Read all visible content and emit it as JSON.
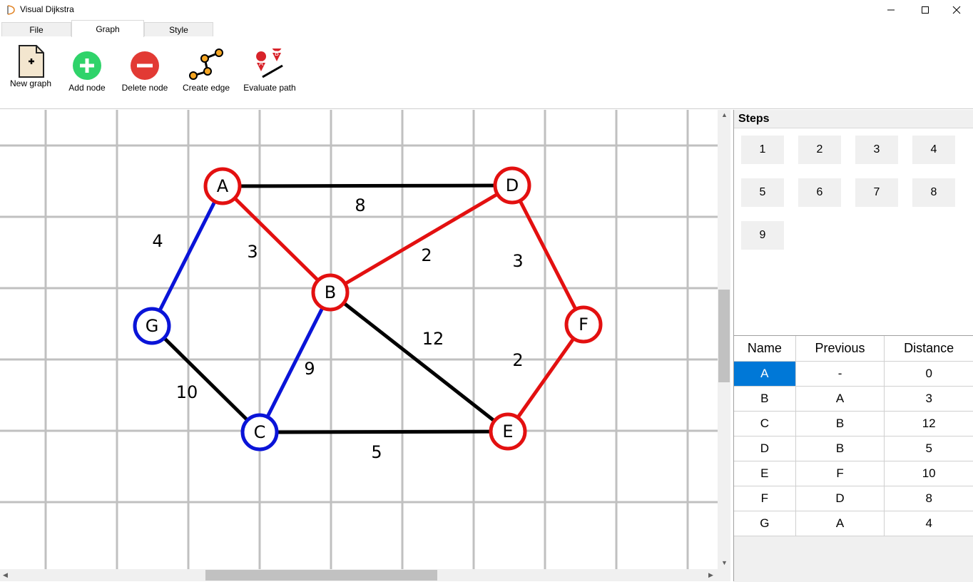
{
  "window": {
    "title": "Visual Dijkstra"
  },
  "tabs": [
    {
      "label": "File"
    },
    {
      "label": "Graph"
    },
    {
      "label": "Style"
    }
  ],
  "ribbon": {
    "new_graph": "New graph",
    "add_node": "Add node",
    "delete_node": "Delete node",
    "create_edge": "Create edge",
    "evaluate_path": "Evaluate path"
  },
  "graph": {
    "nodes": [
      {
        "id": "A",
        "color": "#e31010"
      },
      {
        "id": "B",
        "color": "#e31010"
      },
      {
        "id": "C",
        "color": "#0a14d8"
      },
      {
        "id": "D",
        "color": "#e31010"
      },
      {
        "id": "E",
        "color": "#e31010"
      },
      {
        "id": "F",
        "color": "#e31010"
      },
      {
        "id": "G",
        "color": "#0a14d8"
      }
    ],
    "edges": [
      {
        "from": "A",
        "to": "D",
        "weight": "8",
        "color": "#000000"
      },
      {
        "from": "A",
        "to": "B",
        "weight": "3",
        "color": "#e31010"
      },
      {
        "from": "A",
        "to": "G",
        "weight": "4",
        "color": "#0a14d8"
      },
      {
        "from": "B",
        "to": "D",
        "weight": "2",
        "color": "#e31010"
      },
      {
        "from": "D",
        "to": "F",
        "weight": "3",
        "color": "#e31010"
      },
      {
        "from": "B",
        "to": "E",
        "weight": "12",
        "color": "#000000"
      },
      {
        "from": "B",
        "to": "C",
        "weight": "9",
        "color": "#0a14d8"
      },
      {
        "from": "F",
        "to": "E",
        "weight": "2",
        "color": "#e31010"
      },
      {
        "from": "G",
        "to": "C",
        "weight": "10",
        "color": "#000000"
      },
      {
        "from": "C",
        "to": "E",
        "weight": "5",
        "color": "#000000"
      }
    ]
  },
  "steps": {
    "title": "Steps",
    "items": [
      "1",
      "2",
      "3",
      "4",
      "5",
      "6",
      "7",
      "8",
      "9"
    ]
  },
  "results": {
    "columns": [
      "Name",
      "Previous",
      "Distance"
    ],
    "rows": [
      [
        "A",
        "-",
        "0"
      ],
      [
        "B",
        "A",
        "3"
      ],
      [
        "C",
        "B",
        "12"
      ],
      [
        "D",
        "B",
        "5"
      ],
      [
        "E",
        "F",
        "10"
      ],
      [
        "F",
        "D",
        "8"
      ],
      [
        "G",
        "A",
        "4"
      ]
    ]
  },
  "colors": {
    "selection": "#0078d7",
    "path_red": "#e31010",
    "path_blue": "#0a14d8"
  }
}
